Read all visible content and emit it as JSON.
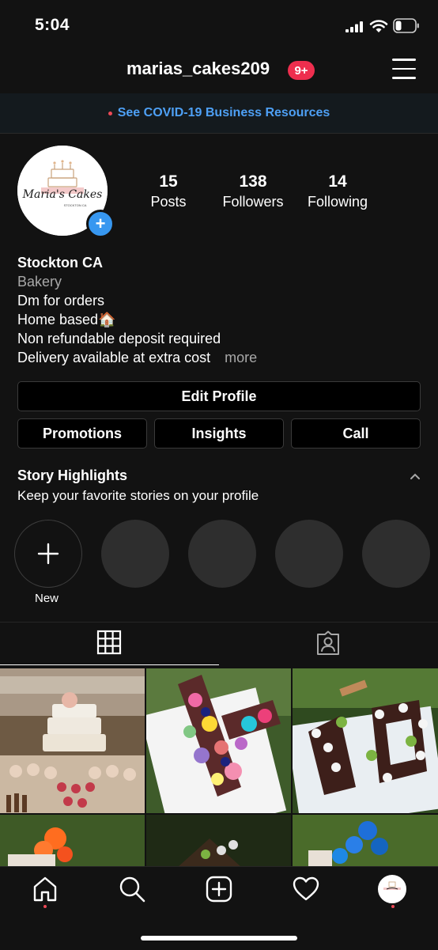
{
  "status_bar": {
    "time": "5:04"
  },
  "header": {
    "username": "marias_cakes209",
    "notification_badge": "9+"
  },
  "covid_banner": {
    "text": "See COVID-19 Business Resources"
  },
  "profile": {
    "avatar_logo_text": "Maria's Cakes",
    "avatar_logo_subtext": "STOCKTON CA",
    "stats": [
      {
        "value": "15",
        "label": "Posts"
      },
      {
        "value": "138",
        "label": "Followers"
      },
      {
        "value": "14",
        "label": "Following"
      }
    ],
    "bio": {
      "name": "Stockton CA",
      "category": "Bakery",
      "lines": [
        "Dm for orders",
        "Home based🏠",
        "Non refundable deposit required",
        "Delivery available at extra cost"
      ],
      "more_label": "more"
    }
  },
  "buttons": {
    "edit_profile": "Edit Profile",
    "promotions": "Promotions",
    "insights": "Insights",
    "call": "Call"
  },
  "story_highlights": {
    "title": "Story Highlights",
    "subtitle": "Keep your favorite stories on your profile",
    "new_label": "New"
  },
  "tabs": [
    {
      "icon": "grid-icon",
      "active": true
    },
    {
      "icon": "tagged-icon",
      "active": false
    }
  ],
  "bottom_nav": [
    {
      "icon": "home-icon"
    },
    {
      "icon": "search-icon"
    },
    {
      "icon": "new-post-icon"
    },
    {
      "icon": "activity-heart-icon"
    },
    {
      "icon": "profile-avatar-icon"
    }
  ],
  "colors": {
    "background": "#121212",
    "link_blue": "#4ea0f5",
    "badge_red": "#ee2e4e",
    "add_blue": "#3797f0"
  }
}
